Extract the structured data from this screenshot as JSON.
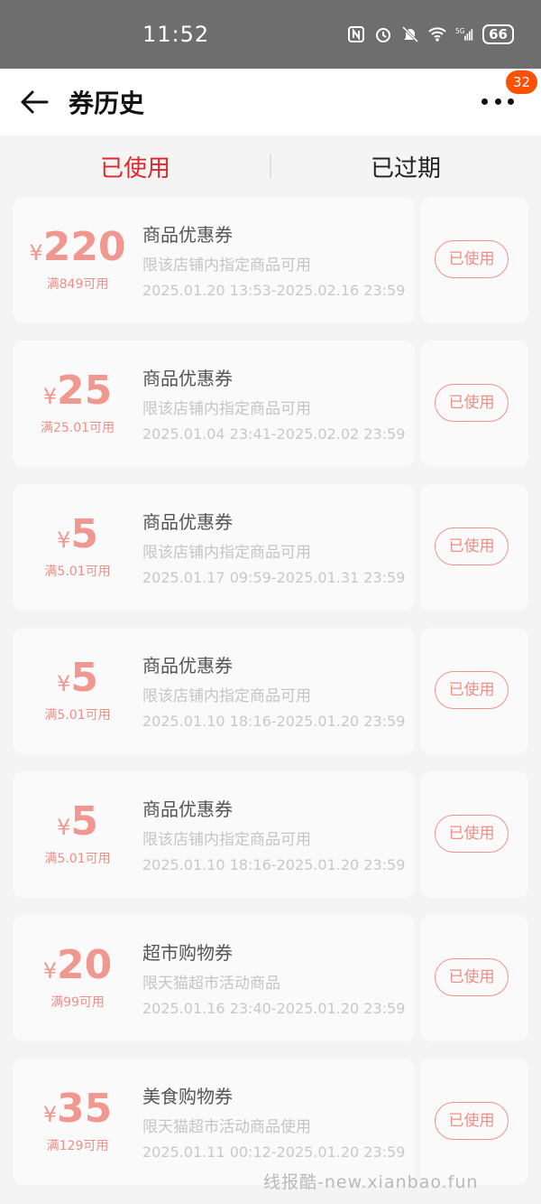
{
  "status": {
    "time": "11:52",
    "battery": "66"
  },
  "header": {
    "title": "券历史",
    "badge": "32"
  },
  "tabs": [
    {
      "label": "已使用"
    },
    {
      "label": "已过期"
    }
  ],
  "coupons": [
    {
      "currency": "¥",
      "amount": "220",
      "condition": "满849可用",
      "title": "商品优惠券",
      "desc": "限该店铺内指定商品可用",
      "date": "2025.01.20 13:53-2025.02.16 23:59",
      "button": "已使用"
    },
    {
      "currency": "¥",
      "amount": "25",
      "condition": "满25.01可用",
      "title": "商品优惠券",
      "desc": "限该店铺内指定商品可用",
      "date": "2025.01.04 23:41-2025.02.02 23:59",
      "button": "已使用"
    },
    {
      "currency": "¥",
      "amount": "5",
      "condition": "满5.01可用",
      "title": "商品优惠券",
      "desc": "限该店铺内指定商品可用",
      "date": "2025.01.17 09:59-2025.01.31 23:59",
      "button": "已使用"
    },
    {
      "currency": "¥",
      "amount": "5",
      "condition": "满5.01可用",
      "title": "商品优惠券",
      "desc": "限该店铺内指定商品可用",
      "date": "2025.01.10 18:16-2025.01.20 23:59",
      "button": "已使用"
    },
    {
      "currency": "¥",
      "amount": "5",
      "condition": "满5.01可用",
      "title": "商品优惠券",
      "desc": "限该店铺内指定商品可用",
      "date": "2025.01.10 18:16-2025.01.20 23:59",
      "button": "已使用"
    },
    {
      "currency": "¥",
      "amount": "20",
      "condition": "满99可用",
      "title": "超市购物券",
      "desc": "限天猫超市活动商品",
      "date": "2025.01.16 23:40-2025.01.20 23:59",
      "button": "已使用"
    },
    {
      "currency": "¥",
      "amount": "35",
      "condition": "满129可用",
      "title": "美食购物券",
      "desc": "限天猫超市活动商品使用",
      "date": "2025.01.11 00:12-2025.01.20 23:59",
      "button": "已使用"
    }
  ],
  "watermark": "线报酷-new.xianbao.fun",
  "colors": {
    "accent": "#e0272b",
    "coupon_red": "#f0978f",
    "badge": "#ff5000"
  }
}
